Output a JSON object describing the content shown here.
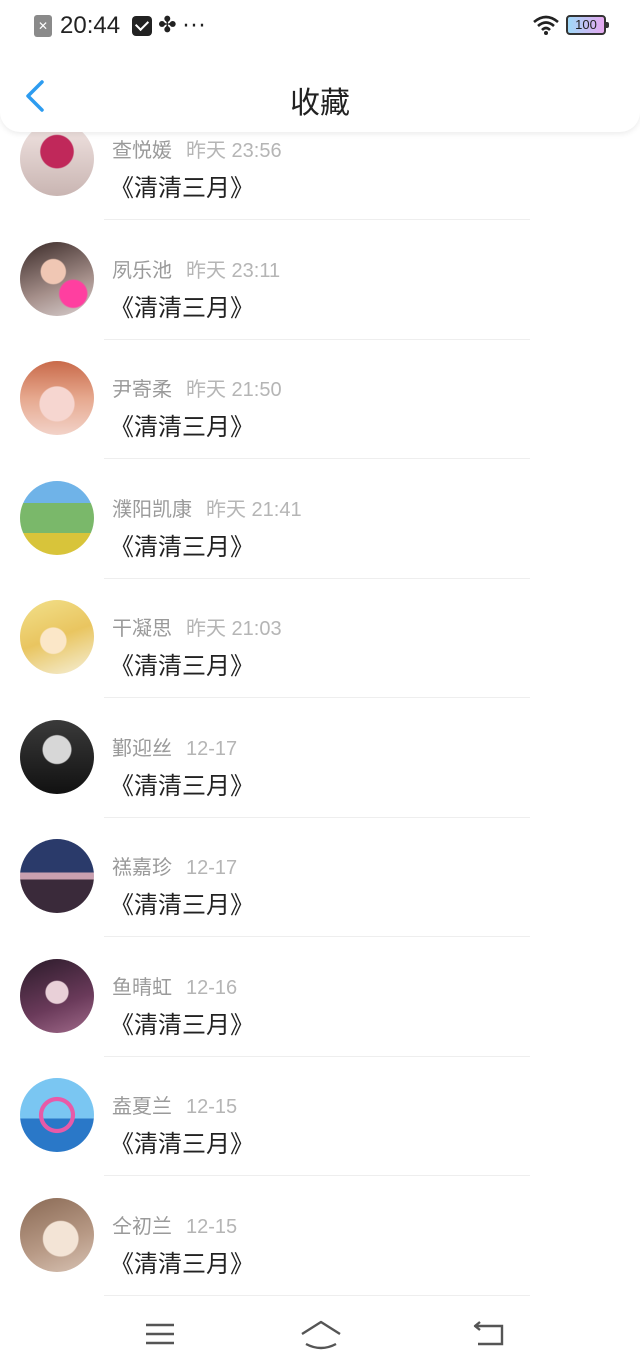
{
  "status_bar": {
    "time": "20:44",
    "battery": "100",
    "dots": "···"
  },
  "header": {
    "title": "收藏"
  },
  "favorites": [
    {
      "user": "查悦媛",
      "time": "昨天 23:56",
      "work": "《清清三月》"
    },
    {
      "user": "夙乐池",
      "time": "昨天 23:11",
      "work": "《清清三月》"
    },
    {
      "user": "尹寄柔",
      "time": "昨天 21:50",
      "work": "《清清三月》"
    },
    {
      "user": "濮阳凯康",
      "time": "昨天 21:41",
      "work": "《清清三月》"
    },
    {
      "user": "干凝思",
      "time": "昨天 21:03",
      "work": "《清清三月》"
    },
    {
      "user": "鄞迎丝",
      "time": "12-17",
      "work": "《清清三月》"
    },
    {
      "user": "禚嘉珍",
      "time": "12-17",
      "work": "《清清三月》"
    },
    {
      "user": "鱼晴虹",
      "time": "12-16",
      "work": "《清清三月》"
    },
    {
      "user": "盍夏兰",
      "time": "12-15",
      "work": "《清清三月》"
    },
    {
      "user": "仝初兰",
      "time": "12-15",
      "work": "《清清三月》"
    }
  ],
  "colors": {
    "accent": "#2d9cf0",
    "text_primary": "#222222",
    "text_secondary": "#9a9a9a"
  }
}
